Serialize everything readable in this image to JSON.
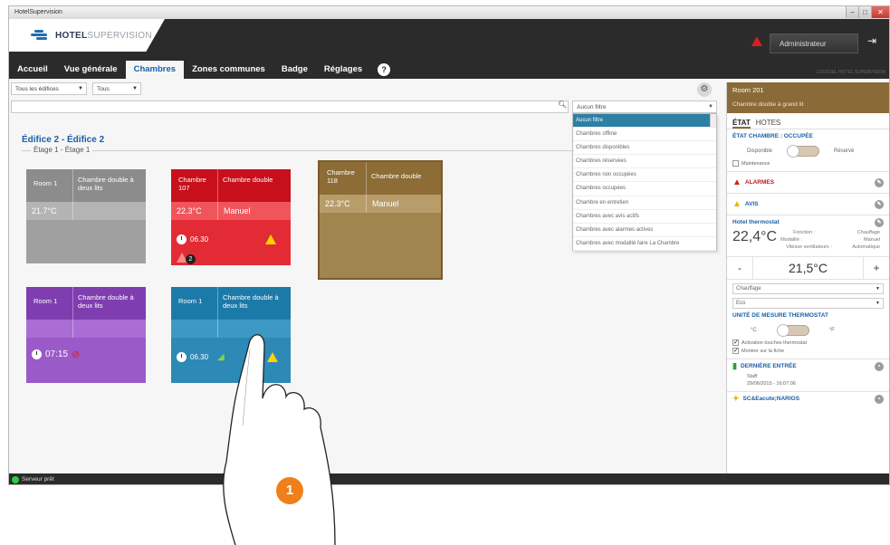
{
  "window": {
    "title": "HotelSupervision",
    "min": "–",
    "max": "□",
    "close": "✕"
  },
  "header": {
    "logo_main": "HOTEL",
    "logo_sub": "SUPERVISION",
    "user_label": "Administrateur",
    "version": "LOGICIEL HOTEL SUPERVISION"
  },
  "tabs": [
    {
      "label": "Accueil"
    },
    {
      "label": "Vue générale"
    },
    {
      "label": "Chambres"
    },
    {
      "label": "Zones communes"
    },
    {
      "label": "Badge"
    },
    {
      "label": "Réglages"
    }
  ],
  "help_label": "?",
  "filters": {
    "building": "Tous les édifices",
    "floor": "Tous",
    "room_filter": "Aucun filtre",
    "options": [
      "Aucun filtre",
      "Chambres offline",
      "Chambres disponibles",
      "Chambres réservées",
      "Chambres non occupées",
      "Chambres occupées",
      "Chambre en entretien",
      "Chambres avec avis actifs",
      "Chambres avec alarmes actives",
      "Chambres avec modalité faire La Chambre"
    ]
  },
  "building": {
    "title": "Édifice 2 - Édifice 2",
    "floor": "Étage 1 - Étage 1"
  },
  "rooms": [
    {
      "name": "Room 1",
      "type": "Chambre double à deux lits",
      "temp": "21.7°C",
      "mode": ""
    },
    {
      "name": "Chambre 107",
      "type": "Chambre double",
      "temp": "22.3°C",
      "mode": "Manuel",
      "time": "06.30",
      "alarm_count": "2"
    },
    {
      "name": "Chambre 118",
      "type": "Chambre double",
      "temp": "22.3°C",
      "mode": "Manuel"
    },
    {
      "name": "Room 1",
      "type": "Chambre double à deux lits",
      "temp": "",
      "mode": "",
      "time": "07:15"
    },
    {
      "name": "Room 1",
      "type": "Chambre double à deux lits",
      "temp": "",
      "mode": "",
      "time": "06.30"
    }
  ],
  "panel": {
    "room": "Room 201",
    "room_type": "Chambre double à grand lit",
    "tab_state": "ÉTAT",
    "tab_guests": "HOTES",
    "state_title": "ÉTAT CHAMBRE : OCCUPÉE",
    "available": "Disponible",
    "reserved": "Réservé",
    "maintenance": "Maintenance",
    "alarms": "ALARMES",
    "notices": "AVIS",
    "thermostat": "Hotel thermostat",
    "current_temp": "22,4°C",
    "function_label": "Fonction :",
    "function_value": "Chauffage",
    "mode_label": "Modalité :",
    "mode_value": "Manuel",
    "fan_label": "Vitesse ventilateurs :",
    "fan_value": "Automatique",
    "setpoint": "21,5°C",
    "minus": "-",
    "plus": "+",
    "select_function": "Chauffage",
    "select_eco": "Eco",
    "unit_title": "UNITÉ DE MESURE THERMOSTAT",
    "unit_c": "°C",
    "unit_f": "°F",
    "activation": "Activation touches thermostat",
    "show_on_card": "Montrer sur la fiche",
    "last_entry": "DERNIÈRE ENTRÉE",
    "last_entry_who": "Staff",
    "last_entry_when": "29/06/2015 - 16:07:06",
    "scenarios": "SC&Eacute;NARIOS"
  },
  "status": {
    "text": "Serveur prêt"
  },
  "step": "1"
}
